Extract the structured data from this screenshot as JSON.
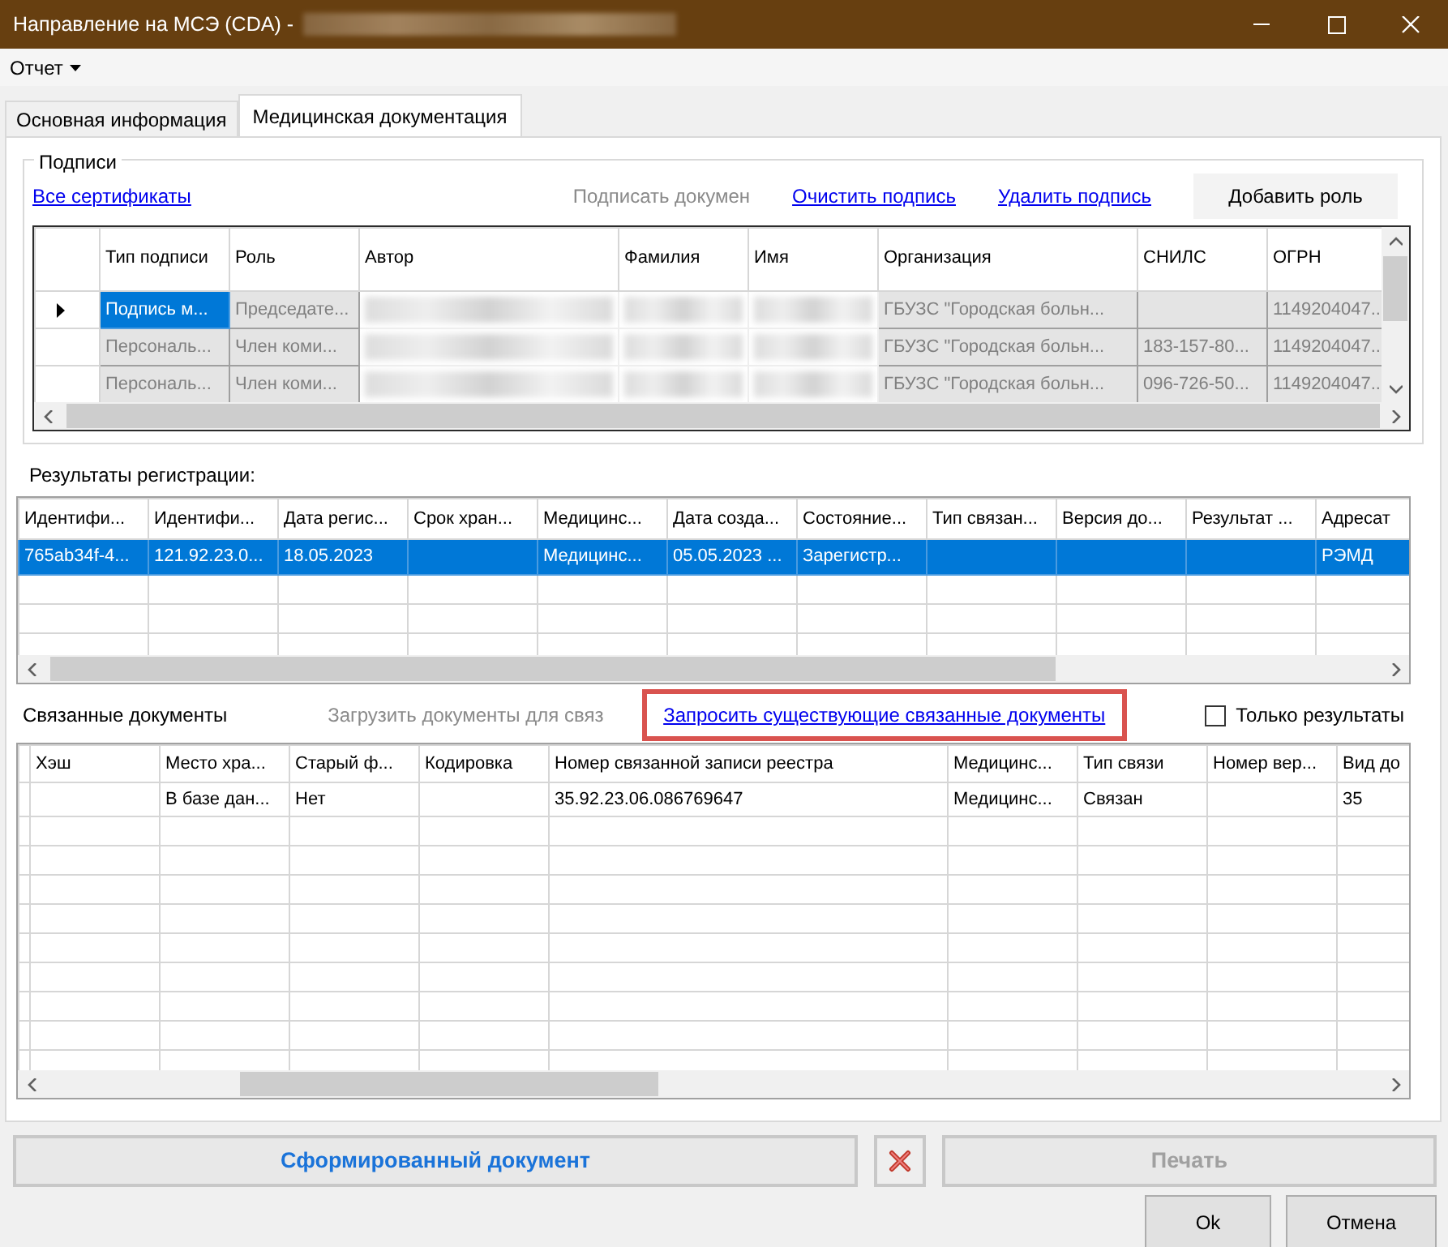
{
  "window": {
    "title": "Направление на МСЭ (CDA) -",
    "title_redacted": true
  },
  "menu": [
    {
      "label": "Отчет",
      "has_dropdown": true
    }
  ],
  "tabs": [
    {
      "label": "Основная информация",
      "selected": false
    },
    {
      "label": "Медицинская документация",
      "selected": true
    }
  ],
  "signatures": {
    "group_title": "Подписи",
    "actions": [
      {
        "kind": "link",
        "label": "Все сертификаты",
        "disabled": false
      },
      {
        "kind": "link",
        "label": "Подписать докумен",
        "disabled": true
      },
      {
        "kind": "link",
        "label": "Очистить подпись",
        "disabled": false
      },
      {
        "kind": "link",
        "label": "Удалить подпись",
        "disabled": false
      },
      {
        "kind": "button",
        "label": "Добавить роль",
        "disabled": false
      }
    ],
    "columns": [
      {
        "label": "Тип подписи"
      },
      {
        "label": "Роль"
      },
      {
        "label": "Автор",
        "redacted": true
      },
      {
        "label": "Фамилия",
        "redacted": true
      },
      {
        "label": "Имя",
        "redacted": true
      },
      {
        "label": "Организация"
      },
      {
        "label": "СНИЛС"
      },
      {
        "label": "ОГРН"
      }
    ],
    "rows": [
      {
        "selected": true,
        "cells": [
          "Подпись м...",
          "Председате...",
          null,
          null,
          null,
          "ГБУЗС \"Городская больн...",
          null,
          "1149204047..."
        ]
      },
      {
        "selected": false,
        "cells": [
          "Персональ...",
          "Член коми...",
          null,
          null,
          null,
          "ГБУЗС \"Городская больн...",
          "183-157-80...",
          "1149204047..."
        ]
      },
      {
        "selected": false,
        "cells": [
          "Персональ...",
          "Член коми...",
          null,
          null,
          null,
          "ГБУЗС \"Городская больн...",
          "096-726-50...",
          "1149204047..."
        ]
      }
    ]
  },
  "registration": {
    "title": "Результаты регистрации:",
    "columns": [
      "Идентифи...",
      "Идентифи...",
      "Дата регис...",
      "Срок хран...",
      "Медицинс...",
      "Дата созда...",
      "Состояние...",
      "Тип связан...",
      "Версия до...",
      "Результат ...",
      "Адресат"
    ],
    "rows": [
      {
        "selected": true,
        "cells": [
          "765ab34f-4...",
          "121.92.23.0...",
          "18.05.2023",
          null,
          "Медицинс...",
          "05.05.2023 ...",
          "Зарегистр...",
          null,
          null,
          null,
          "РЭМД"
        ]
      }
    ]
  },
  "related": {
    "title": "Связанные документы",
    "load_button": {
      "label": "Загрузить документы для связ",
      "disabled": true
    },
    "request_link": {
      "label": "Запросить существующие связанные документы",
      "highlighted": true
    },
    "only_results": {
      "label": "Только результаты",
      "checked": false
    },
    "columns": [
      "Хэш",
      "Место хра...",
      "Старый ф...",
      "Кодировка",
      "Номер связанной записи реестра",
      "Медицинс...",
      "Тип связи",
      "Номер вер...",
      "Вид до"
    ],
    "rows": [
      {
        "selected": false,
        "cells": [
          null,
          "В базе дан...",
          "Нет",
          null,
          "35.92.23.06.086769647",
          "Медицинс...",
          "Связан",
          null,
          "35"
        ]
      }
    ]
  },
  "footer": {
    "document_button": {
      "label": "Сформированный документ"
    },
    "print_button": {
      "label": "Печать",
      "disabled": true
    },
    "ok_button": {
      "label": "Ok"
    },
    "cancel_button": {
      "label": "Отмена"
    }
  }
}
